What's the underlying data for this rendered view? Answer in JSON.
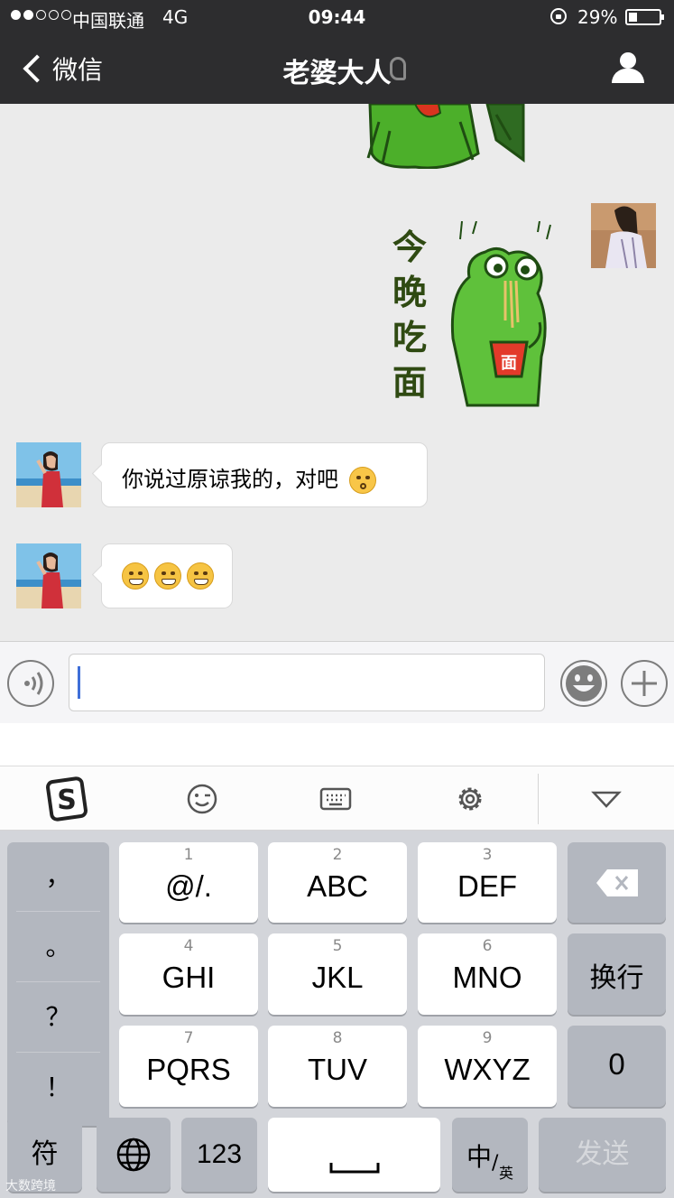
{
  "status_bar": {
    "carrier": "中国联通",
    "network": "4G",
    "time": "09:44",
    "battery_percent": "29%",
    "battery_level": 0.29,
    "signal_filled": 2,
    "signal_total": 5
  },
  "nav": {
    "back_label": "微信",
    "title": "老婆大人",
    "icons": {
      "back": "chevron-left-icon",
      "listen": "ear-icon",
      "profile": "person-icon"
    }
  },
  "messages": [
    {
      "from": "self",
      "type": "sticker",
      "description_icon": "green-frog-sticker"
    },
    {
      "from": "self",
      "type": "sticker",
      "sticker_text": "今晚吃面",
      "cup_text": "面"
    },
    {
      "from": "other",
      "type": "text",
      "text": "你说过原谅我的，对吧",
      "trailing_emoji": "kissing-face-emoji"
    },
    {
      "from": "other",
      "type": "emoji",
      "emojis": [
        "grimacing-face-emoji",
        "grimacing-face-emoji",
        "grimacing-face-emoji"
      ]
    }
  ],
  "input_bar": {
    "voice_icon": "voice-icon",
    "emoji_icon": "smiley-icon",
    "more_icon": "plus-icon",
    "value": ""
  },
  "keyboard_toolbar": {
    "icons": [
      "sogou-logo-icon",
      "wink-face-icon",
      "keyboard-icon",
      "gear-icon",
      "triangle-down-icon"
    ]
  },
  "keyboard": {
    "punctuation": [
      "，",
      "。",
      "？",
      "！"
    ],
    "keys": [
      {
        "num": "1",
        "label": "@/."
      },
      {
        "num": "2",
        "label": "ABC"
      },
      {
        "num": "3",
        "label": "DEF"
      },
      {
        "num": "4",
        "label": "GHI"
      },
      {
        "num": "5",
        "label": "JKL"
      },
      {
        "num": "6",
        "label": "MNO"
      },
      {
        "num": "7",
        "label": "PQRS"
      },
      {
        "num": "8",
        "label": "TUV"
      },
      {
        "num": "9",
        "label": "WXYZ"
      }
    ],
    "newline_label": "换行",
    "zero_label": "0",
    "symbols_label": "符",
    "numbers_label": "123",
    "lang_main": "中",
    "lang_sub": "英",
    "send_label": "发送",
    "globe_icon": "globe-icon",
    "backspace_icon": "backspace-icon",
    "space_icon": "space-icon"
  },
  "watermark": "大数跨境"
}
